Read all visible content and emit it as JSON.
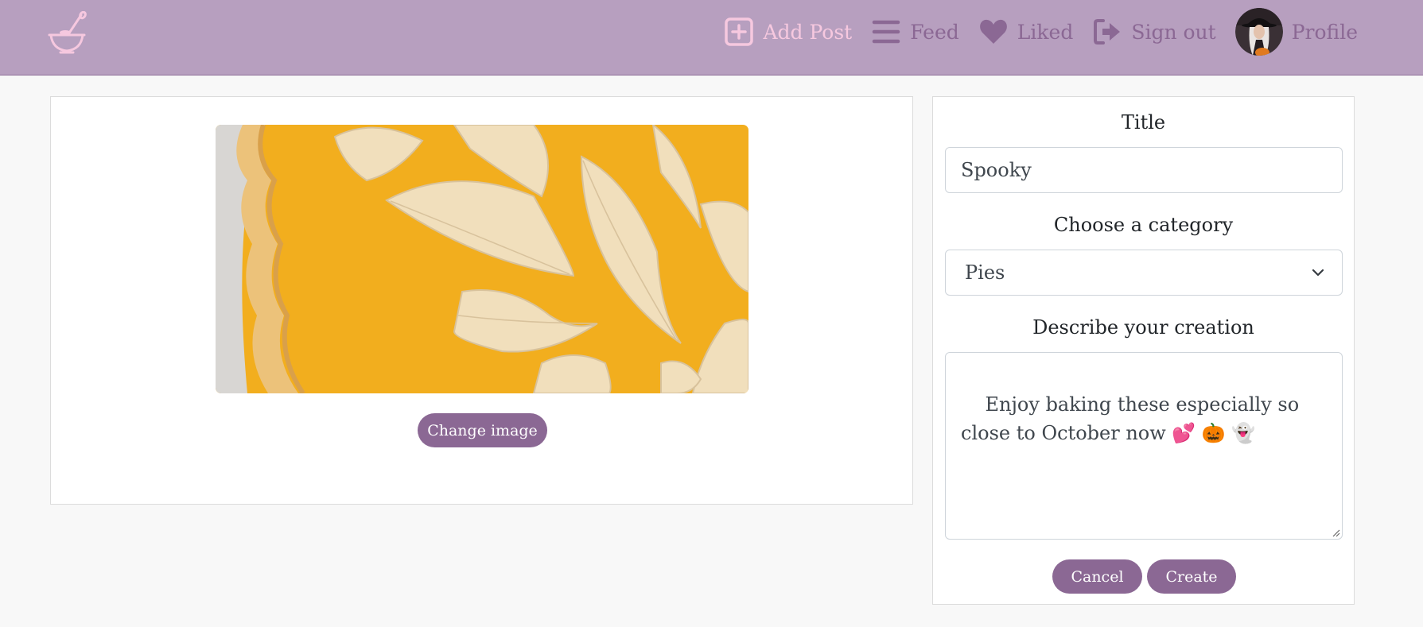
{
  "nav": {
    "brand_icon": "mixing-bowl-whisk-icon",
    "links": [
      {
        "label": "Add Post",
        "icon": "plus-square-icon",
        "active": true
      },
      {
        "label": "Feed",
        "icon": "bars-icon"
      },
      {
        "label": "Liked",
        "icon": "heart-icon"
      },
      {
        "label": "Sign out",
        "icon": "sign-out-icon"
      },
      {
        "label": "Profile",
        "icon": "avatar"
      }
    ]
  },
  "image_panel": {
    "change_image_label": "Change image"
  },
  "form": {
    "title_label": "Title",
    "title_value": "Spooky",
    "category_label": "Choose a category",
    "category_value": "Pies",
    "description_label": "Describe your creation",
    "description_value": "Enjoy baking these especially so close to October now 💕 🎃 👻",
    "cancel_label": "Cancel",
    "create_label": "Create"
  },
  "colors": {
    "navbar_bg": "#b79fbf",
    "accent": "#8b6894",
    "active_link": "#f6c8df",
    "page_bg": "#f8f8f8"
  }
}
